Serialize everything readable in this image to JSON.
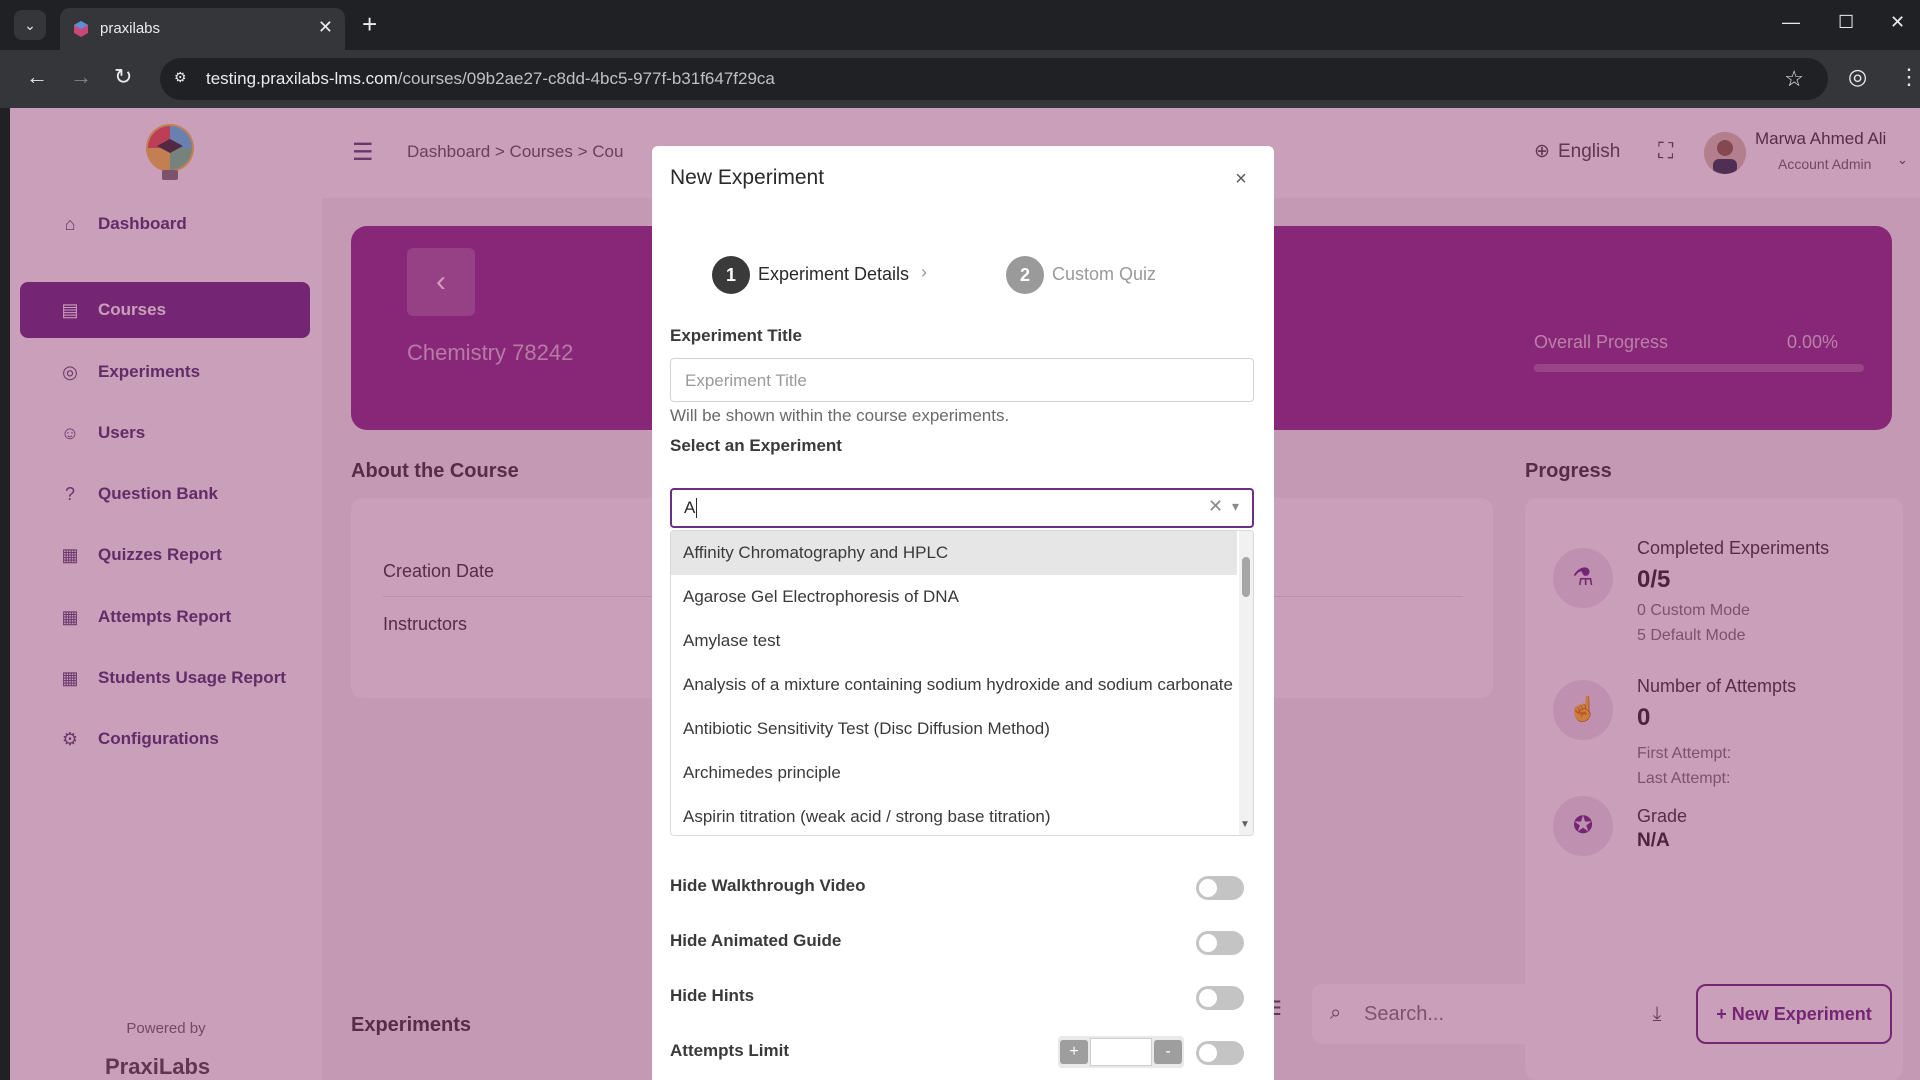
{
  "browser": {
    "tab_title": "praxilabs",
    "url_host": "testing.praxilabs-lms.com",
    "url_path": "/courses/09b2ae27-c8dd-4bc5-977f-b31f647f29ca"
  },
  "sidebar": {
    "items": [
      {
        "label": "Dashboard",
        "icon": "home-icon",
        "active": false
      },
      {
        "label": "Courses",
        "icon": "book-icon",
        "active": true
      },
      {
        "label": "Experiments",
        "icon": "aperture-icon",
        "active": false
      },
      {
        "label": "Users",
        "icon": "user-icon",
        "active": false
      },
      {
        "label": "Question Bank",
        "icon": "question-icon",
        "active": false
      },
      {
        "label": "Quizzes Report",
        "icon": "report-icon",
        "active": false
      },
      {
        "label": "Attempts Report",
        "icon": "report-icon",
        "active": false
      },
      {
        "label": "Students Usage Report",
        "icon": "report-icon",
        "active": false
      },
      {
        "label": "Configurations",
        "icon": "gear-icon",
        "active": false
      }
    ],
    "powered_by": "Powered by",
    "brand": "PraxiLabs"
  },
  "header": {
    "breadcrumb": "Dashboard  >  Courses  >  Cou",
    "language": "English",
    "user_name": "Marwa Ahmed Ali",
    "user_role": "Account Admin"
  },
  "course": {
    "name": "Chemistry 78242",
    "overall_progress_label": "Overall Progress",
    "overall_progress_value": "0.00%"
  },
  "about": {
    "title": "About the Course",
    "creation_date_label": "Creation Date",
    "instructors_label": "Instructors"
  },
  "progress": {
    "title": "Progress",
    "completed_title": "Completed Experiments",
    "completed_value": "0/5",
    "custom_mode": "0 Custom Mode",
    "default_mode": "5 Default Mode",
    "attempts_title": "Number of Attempts",
    "attempts_value": "0",
    "first_attempt": "First Attempt:",
    "last_attempt": "Last Attempt:",
    "grade_title": "Grade",
    "grade_value": "N/A"
  },
  "experiments_section": {
    "title": "Experiments",
    "search_placeholder": "Search...",
    "new_button": "+  New Experiment"
  },
  "modal": {
    "title": "New Experiment",
    "close": "×",
    "steps": [
      {
        "num": "1",
        "label": "Experiment Details",
        "active": true
      },
      {
        "num": "2",
        "label": "Custom Quiz",
        "active": false
      }
    ],
    "title_label": "Experiment Title",
    "title_placeholder": "Experiment Title",
    "title_hint": "Will be shown within the course experiments.",
    "select_label": "Select an Experiment",
    "select_typed": "A",
    "options": [
      "Affinity Chromatography and HPLC",
      "Agarose Gel Electrophoresis of DNA",
      "Amylase test",
      "Analysis of a mixture containing sodium hydroxide and sodium carbonate",
      "Antibiotic Sensitivity Test (Disc Diffusion Method)",
      "Archimedes principle",
      "Aspirin titration (weak acid / strong base titration)"
    ],
    "toggles": [
      {
        "label": "Hide Walkthrough Video"
      },
      {
        "label": "Hide Animated Guide"
      },
      {
        "label": "Hide Hints"
      },
      {
        "label": "Attempts Limit"
      }
    ],
    "attempts_plus": "+",
    "attempts_minus": "-"
  },
  "colors": {
    "brand": "#6b2f8a",
    "hero": "#8d2f8e",
    "overlay": "#801a58"
  }
}
